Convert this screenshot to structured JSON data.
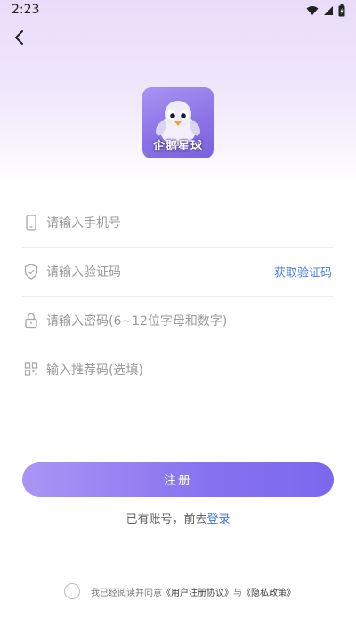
{
  "status_bar": {
    "time": "2:23"
  },
  "header": {
    "back_icon": "chevron-left-icon"
  },
  "logo": {
    "name": "企鹅星球"
  },
  "form": {
    "phone_placeholder": "请输入手机号",
    "code_placeholder": "请输入验证码",
    "get_code_label": "获取验证码",
    "password_placeholder": "请输入密码(6~12位字母和数字)",
    "referral_placeholder": "输入推荐码(选填)"
  },
  "register_label": "注册",
  "login_prompt": {
    "text": "已有账号，前去",
    "link": "登录"
  },
  "agreement": {
    "prefix": "我已经阅读并同意",
    "user_agreement": "《用户注册协议》",
    "and": "与",
    "privacy_policy": "《隐私政策》"
  },
  "colors": {
    "accent": "#7b68ee",
    "link": "#4a7ee8"
  }
}
